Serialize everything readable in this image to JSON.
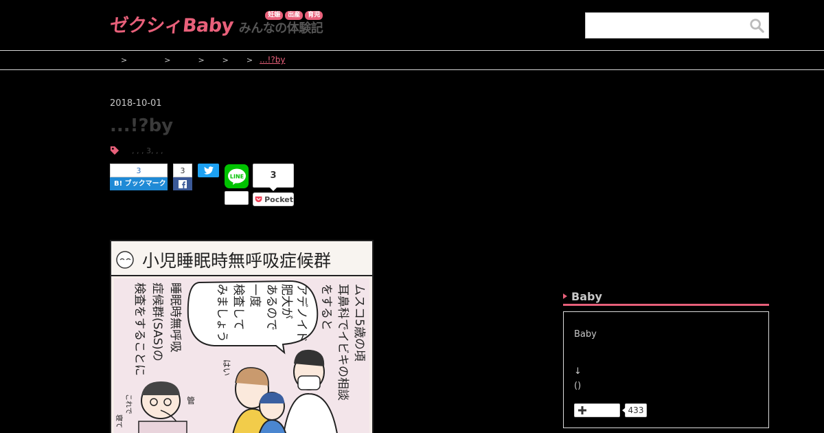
{
  "header": {
    "logo_main": "ゼクシィBaby",
    "logo_tags": [
      "妊娠",
      "出産",
      "育児"
    ],
    "logo_sub": "みんなの体験記",
    "search_placeholder": ""
  },
  "breadcrumb": {
    "items": [
      "",
      "",
      "",
      "",
      "",
      "...!?by"
    ],
    "separator": ">"
  },
  "article": {
    "date": "2018-10-01",
    "title": "...!?by",
    "tags_text": ", , , 3, , ,"
  },
  "share": {
    "hatena_count": "3",
    "hatena_label": "B! ブックマーク",
    "facebook_count": "3",
    "pocket_count": "3",
    "pocket_label": "Pocket",
    "line_label": "LINE"
  },
  "manga": {
    "title_text": "小児睡眠時無呼吸症候群",
    "bubble_text": [
      "アデノイド",
      "肥大が",
      "あるので",
      "一度",
      "検査して",
      "みましょう"
    ],
    "narration_right": [
      "ムスコ5歳の頃",
      "耳鼻科でイビキの相談",
      "をすると"
    ],
    "narration_left": [
      "睡眠時無呼吸",
      "症候群(SAS)の",
      "検査をすることに"
    ],
    "small_labels": [
      "はい",
      "管",
      "これで",
      "寝て"
    ]
  },
  "sidebar": {
    "widget_title": "Baby",
    "line1": "Baby",
    "line2": "↓",
    "line3": "()",
    "follow_count": "433"
  },
  "colors": {
    "accent": "#e8607a",
    "hatena": "#1f8ad6",
    "facebook": "#3b5998",
    "twitter": "#1da1f2",
    "line": "#00c300",
    "pocket": "#ef4056"
  }
}
